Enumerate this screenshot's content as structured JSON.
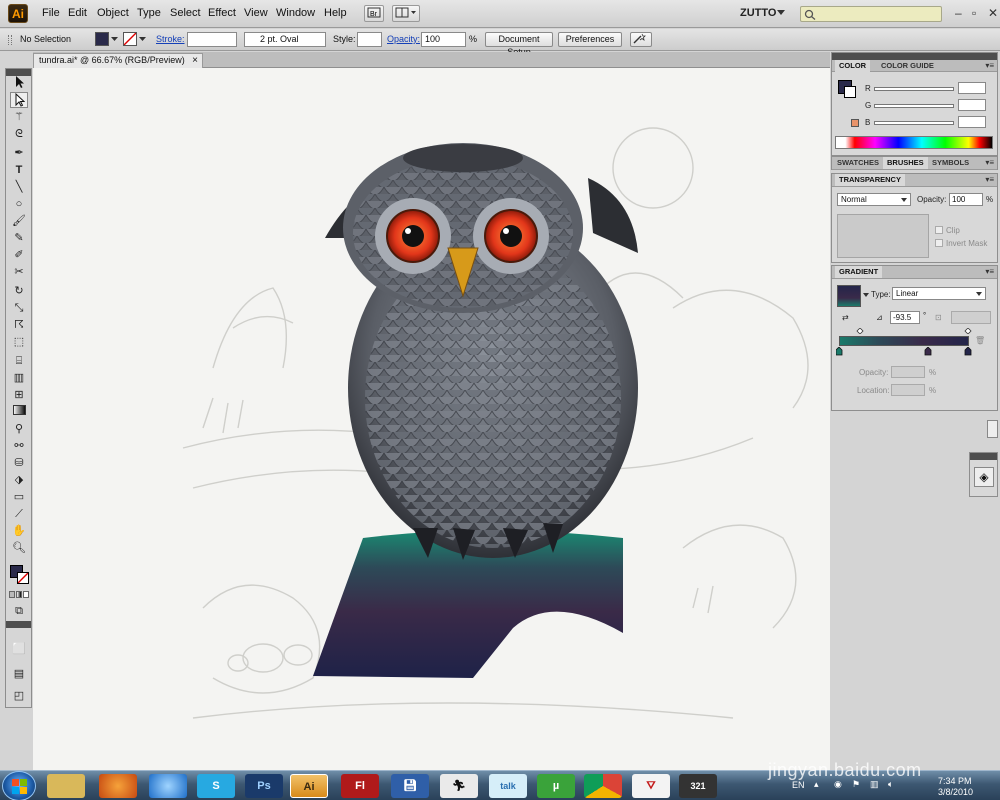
{
  "app": {
    "logo": "Ai",
    "workspace": "ZUTTO"
  },
  "menu": [
    "File",
    "Edit",
    "Object",
    "Type",
    "Select",
    "Effect",
    "View",
    "Window",
    "Help"
  ],
  "control_bar": {
    "selection": "No Selection",
    "stroke_label": "Stroke:",
    "brush": "2 pt. Oval",
    "style_label": "Style:",
    "opacity_label": "Opacity:",
    "opacity_value": "100",
    "opacity_unit": "%",
    "doc_setup": "Document Setup",
    "preferences": "Preferences"
  },
  "document": {
    "tab_title": "tundra.ai* @ 66.67% (RGB/Preview)",
    "close": "×"
  },
  "color_panel": {
    "tabs": [
      "COLOR",
      "COLOR GUIDE"
    ],
    "channels": [
      "R",
      "G",
      "B"
    ]
  },
  "swatches_tabs": [
    "SWATCHES",
    "BRUSHES",
    "SYMBOLS"
  ],
  "transparency": {
    "title": "TRANSPARENCY",
    "mode": "Normal",
    "opacity_label": "Opacity:",
    "opacity_value": "100",
    "opacity_unit": "%",
    "clip": "Clip",
    "invert_mask": "Invert Mask"
  },
  "gradient": {
    "title": "GRADIENT",
    "type_label": "Type:",
    "type_value": "Linear",
    "angle": "-93.5",
    "angle_unit": "°",
    "opacity_label": "Opacity:",
    "opacity_unit": "%",
    "location_label": "Location:",
    "location_unit": "%"
  },
  "taskbar": {
    "items": [
      "explorer-icon",
      "firefox-icon",
      "ie-icon",
      "skype-icon",
      "photoshop-icon",
      "illustrator-icon",
      "flash-icon",
      "save-icon",
      "runner-icon",
      "talk-icon",
      "utorrent-icon",
      "chrome-icon",
      "acrobat-icon",
      "media-icon"
    ],
    "ps_label": "Ps",
    "ai_label": "Ai",
    "fl_label": "Fl",
    "talk_label": "talk",
    "ut_label": "µ",
    "media_label": "321",
    "lang": "EN",
    "time": "7:34 PM",
    "date": "3/8/2010"
  },
  "watermark": "jingyan.baidu.com",
  "colors": {
    "accent": "#ff9a00",
    "fill_swatch": "#2a2a4a",
    "stroke_swatch": "#e8936a",
    "gradient_start": "#23254a",
    "gradient_mid": "#3a2a4a",
    "gradient_end": "#1a7a6a"
  }
}
